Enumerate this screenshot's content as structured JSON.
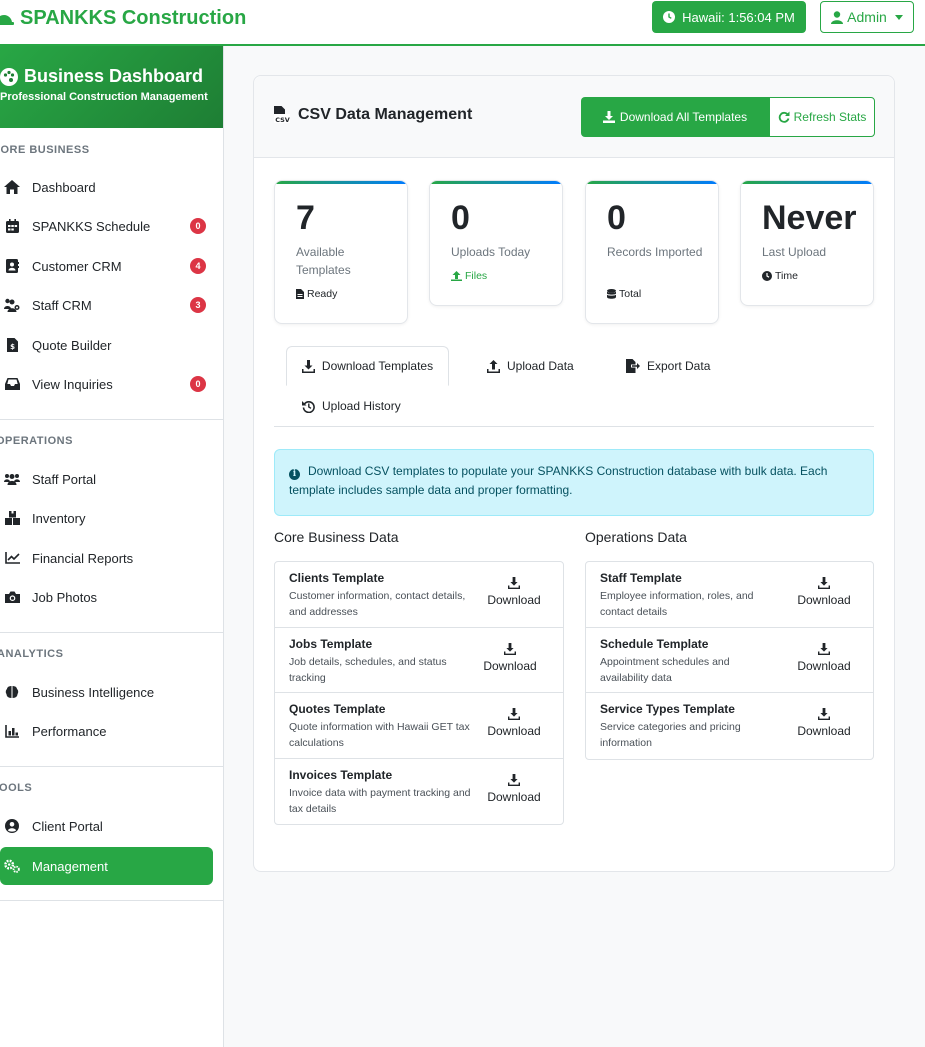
{
  "header": {
    "brand": "SPANKKS Construction",
    "clock": "Hawaii: 1:56:04 PM",
    "user": "Admin"
  },
  "sidebar": {
    "title": "Business Dashboard",
    "subtitle": "Professional Construction Management",
    "sections": [
      {
        "title": "CORE BUSINESS",
        "items": [
          {
            "label": "Dashboard",
            "icon": "home-icon"
          },
          {
            "label": "SPANKKS Schedule",
            "icon": "calendar-icon",
            "badge": "0"
          },
          {
            "label": "Customer CRM",
            "icon": "contact-card-icon",
            "badge": "4"
          },
          {
            "label": "Staff CRM",
            "icon": "users-gear-icon",
            "badge": "3"
          },
          {
            "label": "Quote Builder",
            "icon": "file-invoice-icon"
          },
          {
            "label": "View Inquiries",
            "icon": "inbox-icon",
            "badge": "0"
          }
        ]
      },
      {
        "title": "OPERATIONS",
        "items": [
          {
            "label": "Staff Portal",
            "icon": "users-icon"
          },
          {
            "label": "Inventory",
            "icon": "boxes-icon"
          },
          {
            "label": "Financial Reports",
            "icon": "line-chart-icon"
          },
          {
            "label": "Job Photos",
            "icon": "camera-icon"
          }
        ]
      },
      {
        "title": "ANALYTICS",
        "items": [
          {
            "label": "Business Intelligence",
            "icon": "brain-icon"
          },
          {
            "label": "Performance",
            "icon": "bar-chart-icon"
          }
        ]
      },
      {
        "title": "TOOLS",
        "items": [
          {
            "label": "Client Portal",
            "icon": "user-circle-icon"
          },
          {
            "label": "Management",
            "icon": "cogs-icon",
            "active": true
          }
        ]
      }
    ]
  },
  "card": {
    "title": "CSV Data Management",
    "download_all": "Download All Templates",
    "refresh": "Refresh Stats"
  },
  "stats": [
    {
      "value": "7",
      "label": "Available Templates",
      "sub": "Ready",
      "sub_icon": "file-icon"
    },
    {
      "value": "0",
      "label": "Uploads Today",
      "sub": "Files",
      "sub_icon": "upload-icon"
    },
    {
      "value": "0",
      "label": "Records Imported",
      "sub": "Total",
      "sub_icon": "database-icon"
    },
    {
      "value": "Never",
      "label": "Last Upload",
      "sub": "Time",
      "sub_icon": "clock-icon"
    }
  ],
  "tabs": [
    {
      "label": "Download Templates",
      "active": true
    },
    {
      "label": "Upload Data"
    },
    {
      "label": "Export Data"
    },
    {
      "label": "Upload History"
    }
  ],
  "alert": "Download CSV templates to populate your SPANKKS Construction database with bulk data. Each template includes sample data and proper formatting.",
  "core": {
    "title": "Core Business Data",
    "templates": [
      {
        "name": "Clients Template",
        "desc": "Customer information, contact details, and addresses",
        "action": "Download"
      },
      {
        "name": "Jobs Template",
        "desc": "Job details, schedules, and status tracking",
        "action": "Download"
      },
      {
        "name": "Quotes Template",
        "desc": "Quote information with Hawaii GET tax calculations",
        "action": "Download"
      },
      {
        "name": "Invoices Template",
        "desc": "Invoice data with payment tracking and tax details",
        "action": "Download"
      }
    ]
  },
  "ops": {
    "title": "Operations Data",
    "templates": [
      {
        "name": "Staff Template",
        "desc": "Employee information, roles, and contact details",
        "action": "Download"
      },
      {
        "name": "Schedule Template",
        "desc": "Appointment schedules and availability data",
        "action": "Download"
      },
      {
        "name": "Service Types Template",
        "desc": "Service categories and pricing information",
        "action": "Download"
      }
    ]
  },
  "colors": {
    "brand": "#28a745",
    "badge": "#dc3545",
    "alert_bg": "#cff4fc"
  }
}
